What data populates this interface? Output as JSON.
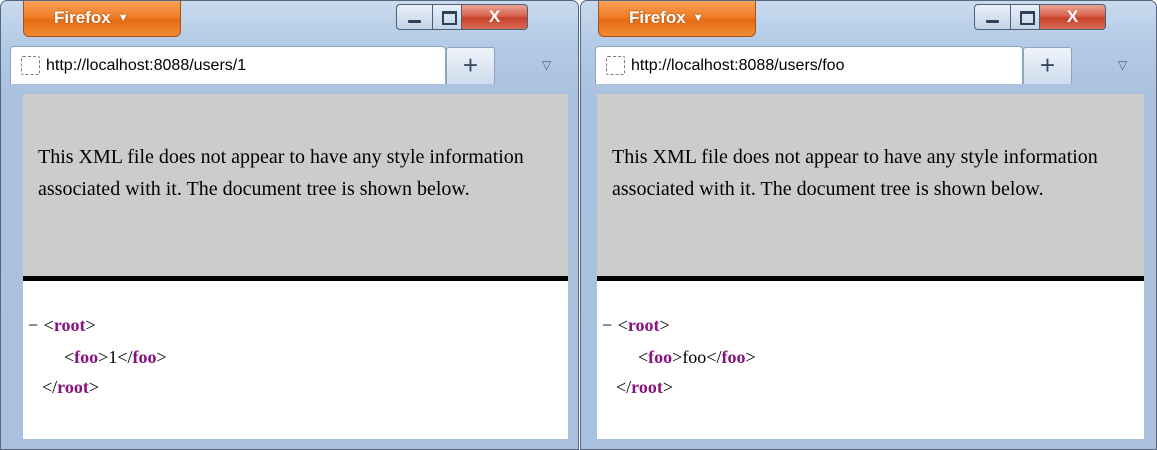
{
  "windows": [
    {
      "app_button": "Firefox",
      "controls": {
        "close": "X"
      },
      "tab": {
        "url": "http://localhost:8088/users/1",
        "new_tab": "+"
      },
      "content": {
        "message": "This XML file does not appear to have any style information associated with it. The document tree is shown below.",
        "tree": {
          "collapse_toggle": "−",
          "root_tag": "root",
          "child_tag": "foo",
          "child_value": "1"
        }
      }
    },
    {
      "app_button": "Firefox",
      "controls": {
        "close": "X"
      },
      "tab": {
        "url": "http://localhost:8088/users/foo",
        "new_tab": "+"
      },
      "content": {
        "message": "This XML file does not appear to have any style information associated with it. The document tree is shown below.",
        "tree": {
          "collapse_toggle": "−",
          "root_tag": "root",
          "child_tag": "foo",
          "child_value": "foo"
        }
      }
    }
  ],
  "colors": {
    "firefox_button": "#e96f16",
    "xml_header_bg": "#cccccc",
    "xml_tag": "#881280",
    "close_button": "#c9442c"
  },
  "icons": {
    "menu_arrow": "triangle-down",
    "tab_list": "triangle-down-outline",
    "favicon": "dashed-square"
  }
}
